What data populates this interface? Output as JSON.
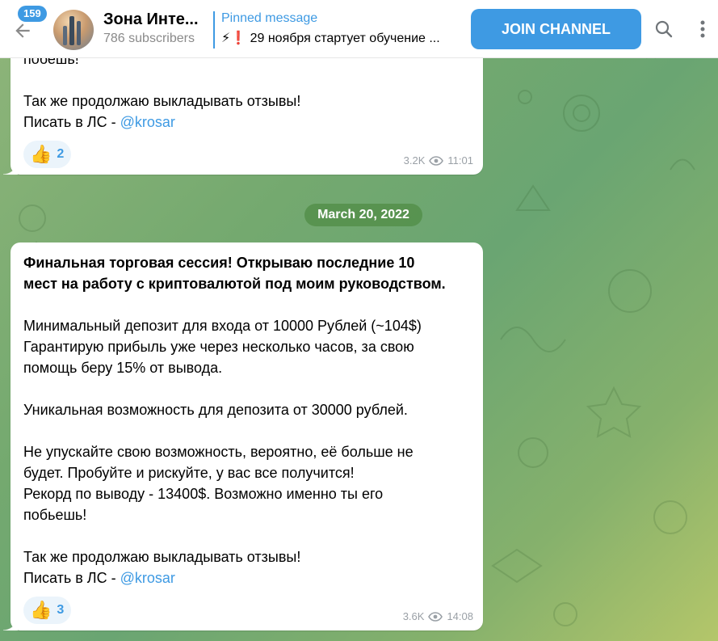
{
  "header": {
    "unread_count": "159",
    "channel_title": "Зона Инте...",
    "subscribers": "786 subscribers",
    "pinned_label": "Pinned message",
    "pinned_text": "⚡❗ 29 ноября стартует обучение ...",
    "join_label": "JOIN CHANNEL"
  },
  "messages": [
    {
      "lines": [
        "побешь!",
        "",
        "Так же продолжаю выкладывать отзывы!"
      ],
      "contact_prefix": "Писать в ЛС - ",
      "contact_link": "@krosar",
      "reaction_emoji": "👍",
      "reaction_count": "2",
      "views": "3.2K",
      "time": "11:01"
    },
    {
      "date": "March 20, 2022",
      "bold_lines": [
        "Финальная торговая сессия! Открываю последние 10",
        "мест на работу с криптовалютой под моим руководством."
      ],
      "lines": [
        "",
        "Минимальный депозит для входа от 10000 Рублей (~104$)",
        "Гарантирую прибыль уже через несколько часов, за свою",
        "помощь беру 15% от вывода.",
        "",
        "Уникальная возможность для депозита от 30000 рублей.",
        "",
        "Не упускайте свою возможность, вероятно, её больше не",
        "будет. Пробуйте и рискуйте, у вас все получится!",
        "Рекорд по выводу - 13400$. Возможно именно ты его",
        "побьешь!",
        "",
        "Так же продолжаю выкладывать отзывы!"
      ],
      "contact_prefix": "Писать в ЛС - ",
      "contact_link": "@krosar",
      "reaction_emoji": "👍",
      "reaction_count": "3",
      "views": "3.6K",
      "time": "14:08"
    }
  ],
  "colors": {
    "accent": "#3e9ae3",
    "bg_green": "#74a96f"
  },
  "icons": [
    "back-arrow-icon",
    "search-icon",
    "more-vertical-icon",
    "eye-icon"
  ]
}
